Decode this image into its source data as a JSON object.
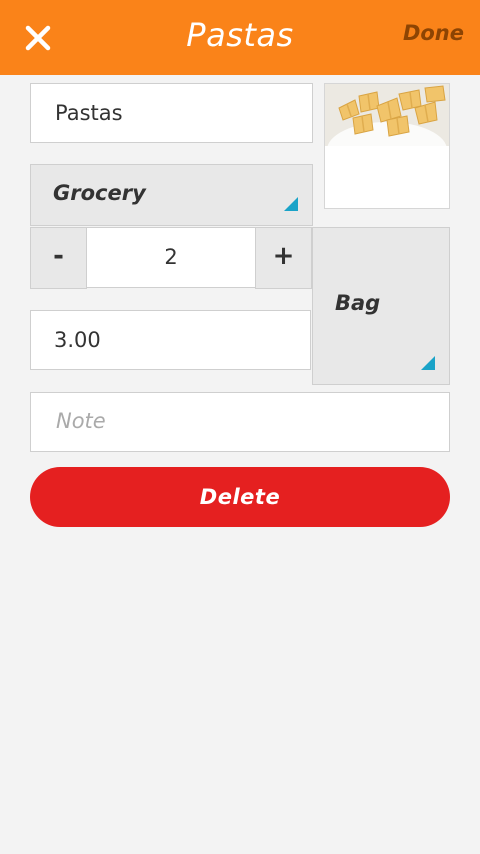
{
  "header": {
    "title": "Pastas",
    "done_label": "Done",
    "close_icon": "close-icon"
  },
  "item": {
    "name": "Pastas",
    "image_icon": "pasta-thumbnail",
    "category": "Grocery",
    "quantity": "2",
    "minus_label": "-",
    "plus_label": "+",
    "unit": "Bag",
    "price": "3.00",
    "note_placeholder": "Note"
  },
  "actions": {
    "delete_label": "Delete"
  },
  "colors": {
    "header_bg": "#fa8319",
    "delete_bg": "#e52020",
    "dropdown_indicator": "#1aa3c8"
  }
}
